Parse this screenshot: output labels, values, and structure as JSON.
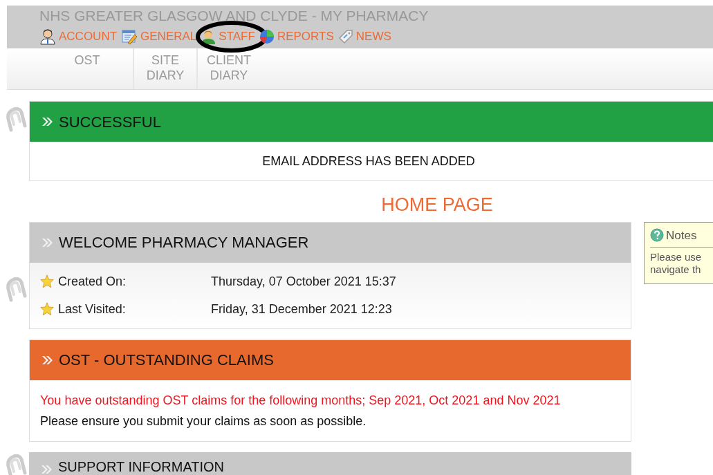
{
  "header": {
    "title": "NHS GREATER GLASGOW AND CLYDE - MY PHARMACY",
    "nav": [
      {
        "label": "ACCOUNT",
        "circled": false
      },
      {
        "label": "GENERAL",
        "circled": false
      },
      {
        "label": "STAFF",
        "circled": true
      },
      {
        "label": "REPORTS",
        "circled": false
      },
      {
        "label": "NEWS",
        "circled": false
      }
    ]
  },
  "subnav": [
    {
      "label": "OST"
    },
    {
      "label": "SITE DIARY"
    },
    {
      "label": "CLIENT DIARY"
    }
  ],
  "success": {
    "kind": "success",
    "title": "SUCCESSFUL",
    "message": "EMAIL ADDRESS HAS BEEN ADDED"
  },
  "page_title": "HOME PAGE",
  "welcome": {
    "kind": "info",
    "title": "WELCOME PHARMACY MANAGER",
    "rows": [
      {
        "label": "Created On:",
        "value": "Thursday, 07 October 2021 15:37"
      },
      {
        "label": "Last Visited:",
        "value": "Friday, 31 December 2021 12:23"
      }
    ]
  },
  "claims": {
    "kind": "warning",
    "title": "OST - OUTSTANDING CLAIMS",
    "alert": "You have outstanding OST claims for the following months; Sep 2021, Oct 2021 and Nov 2021",
    "note": "Please ensure you submit your claims as soon as possible."
  },
  "support": {
    "kind": "info",
    "title": "SUPPORT INFORMATION"
  },
  "notes": {
    "title": "Notes",
    "lines": [
      "Please use",
      "navigate th"
    ]
  }
}
